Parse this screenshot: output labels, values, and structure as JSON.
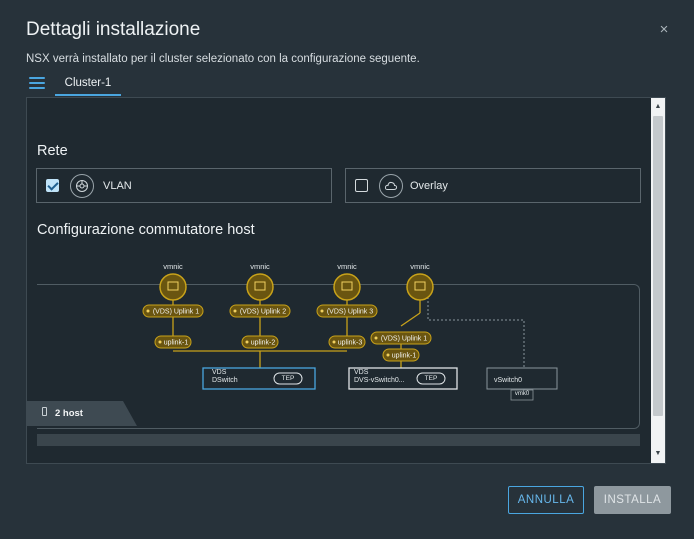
{
  "dialog": {
    "title": "Dettagli installazione",
    "close_glyph": "×",
    "subtitle": "NSX verrà installato per il cluster selezionato con la configurazione seguente."
  },
  "tabs": [
    {
      "label": "Cluster-1",
      "active": true
    }
  ],
  "network": {
    "title": "Rete",
    "options": [
      {
        "label": "VLAN",
        "checked": true,
        "icon": "vlan-globe-icon"
      },
      {
        "label": "Overlay",
        "checked": false,
        "icon": "overlay-cloud-icon"
      }
    ]
  },
  "host_switch": {
    "title": "Configurazione commutatore host",
    "vmnics": [
      "vmnic",
      "vmnic",
      "vmnic",
      "vmnic"
    ],
    "vds_uplinks": [
      "(VDS) Uplink 1",
      "(VDS) Uplink 2",
      "(VDS) Uplink 3",
      "(VDS) Uplink 1"
    ],
    "uplinks": [
      "uplink-1",
      "uplink-2",
      "uplink-3",
      "uplink-1"
    ],
    "switches": [
      {
        "type": "VDS",
        "name": "DSwitch",
        "tep": "TEP"
      },
      {
        "type": "VDS",
        "name": "DVS-vSwitch0...",
        "tep": "TEP"
      },
      {
        "type": "",
        "name": "vSwitch0",
        "tep": ""
      }
    ],
    "vmk_label": "vmk0",
    "host_count": "2 host"
  },
  "footer": {
    "cancel_label": "ANNULLA",
    "install_label": "INSTALLA"
  },
  "colors": {
    "accent": "#4aa6e0",
    "uplink_gold": "#c8a21a",
    "uplink_fill": "#6a5510",
    "background": "#27323a"
  }
}
